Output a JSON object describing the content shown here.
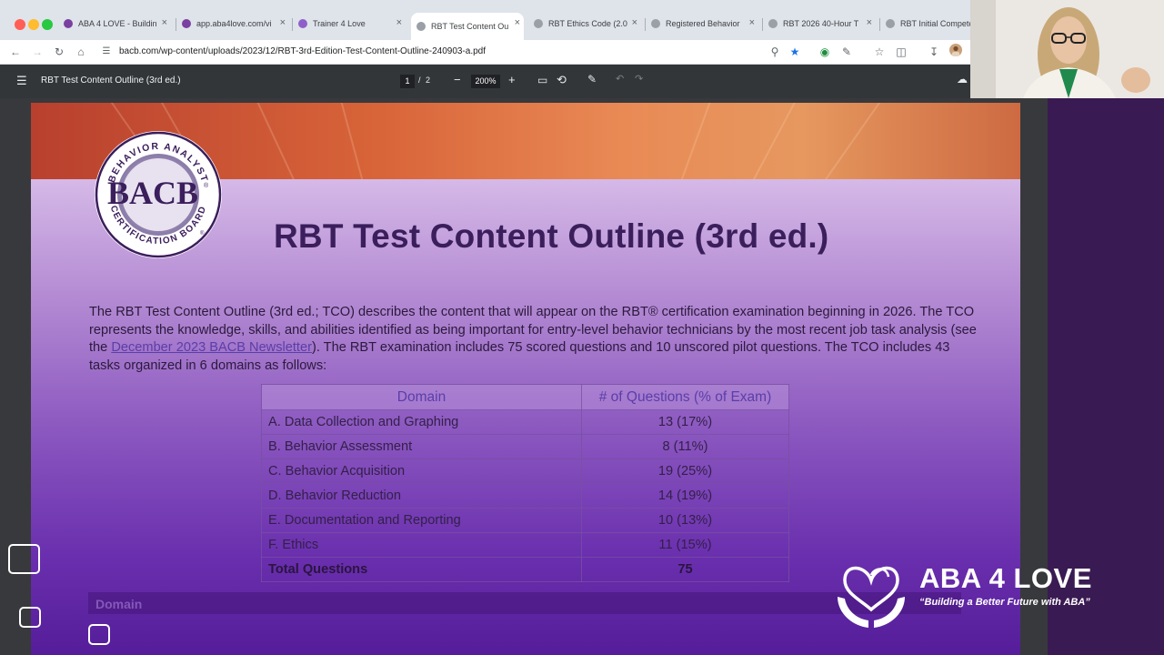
{
  "browser": {
    "tabs": [
      {
        "title": "ABA 4 LOVE - Buildin",
        "fav_color": "#7a3fa0",
        "active": false
      },
      {
        "title": "app.aba4love.com/vi",
        "fav_color": "#7a3fa0",
        "active": false
      },
      {
        "title": "Trainer 4 Love",
        "fav_color": "#8e5fc9",
        "active": false
      },
      {
        "title": "RBT Test Content Ou",
        "fav_color": "#9aa0a6",
        "active": true
      },
      {
        "title": "RBT Ethics Code (2.0",
        "fav_color": "#9aa0a6",
        "active": false
      },
      {
        "title": "Registered Behavior",
        "fav_color": "#9aa0a6",
        "active": false
      },
      {
        "title": "RBT 2026 40-Hour T",
        "fav_color": "#9aa0a6",
        "active": false
      },
      {
        "title": "RBT Initial Competer",
        "fav_color": "#9aa0a6",
        "active": false
      }
    ],
    "url": "bacb.com/wp-content/uploads/2023/12/RBT-3rd-Edition-Test-Content-Outline-240903-a.pdf"
  },
  "pdf_viewer": {
    "title": "RBT Test Content Outline (3rd ed.)",
    "current_page": "1",
    "separator": "/",
    "total_pages": "2",
    "zoom": "200%"
  },
  "document": {
    "logo": {
      "top_arc": "BEHAVIOR ANALYST",
      "wordmark": "BACB",
      "registered": "®",
      "bottom_arc": "CERTIFICATION BOARD",
      "bottom_registered": "®"
    },
    "title": "RBT Test Content Outline (3rd ed.)",
    "intro_before_link": "The RBT Test Content Outline (3rd ed.; TCO) describes the content that will appear on the RBT® certification examination beginning in 2026. The TCO represents the knowledge, skills, and abilities identified as being important for entry-level behavior technicians by the most recent job task analysis (see the ",
    "intro_link": "December 2023 BACB Newsletter",
    "intro_after_link": "). The RBT examination includes 75 scored questions and 10 unscored pilot questions. The TCO includes 43 tasks organized in 6 domains as follows:",
    "table": {
      "headers": [
        "Domain",
        "# of Questions (% of Exam)"
      ],
      "rows": [
        [
          "A. Data Collection and Graphing",
          "13 (17%)"
        ],
        [
          "B. Behavior Assessment",
          "8 (11%)"
        ],
        [
          "C. Behavior Acquisition",
          "19 (25%)"
        ],
        [
          "D. Behavior Reduction",
          "14 (19%)"
        ],
        [
          "E. Documentation and Reporting",
          "10 (13%)"
        ],
        [
          "F. Ethics",
          "11 (15%)"
        ]
      ],
      "total": [
        "Total Questions",
        "75"
      ]
    },
    "next_table_header": "Domain"
  },
  "overlay": {
    "brand_name": "ABA 4 LOVE",
    "brand_tagline": "“Building a Better Future with ABA”"
  },
  "colors": {
    "title": "#3b1e5c",
    "link": "#5a3ea8",
    "banner_orange": "#e98a55",
    "page_purple": "#6a2fae"
  }
}
